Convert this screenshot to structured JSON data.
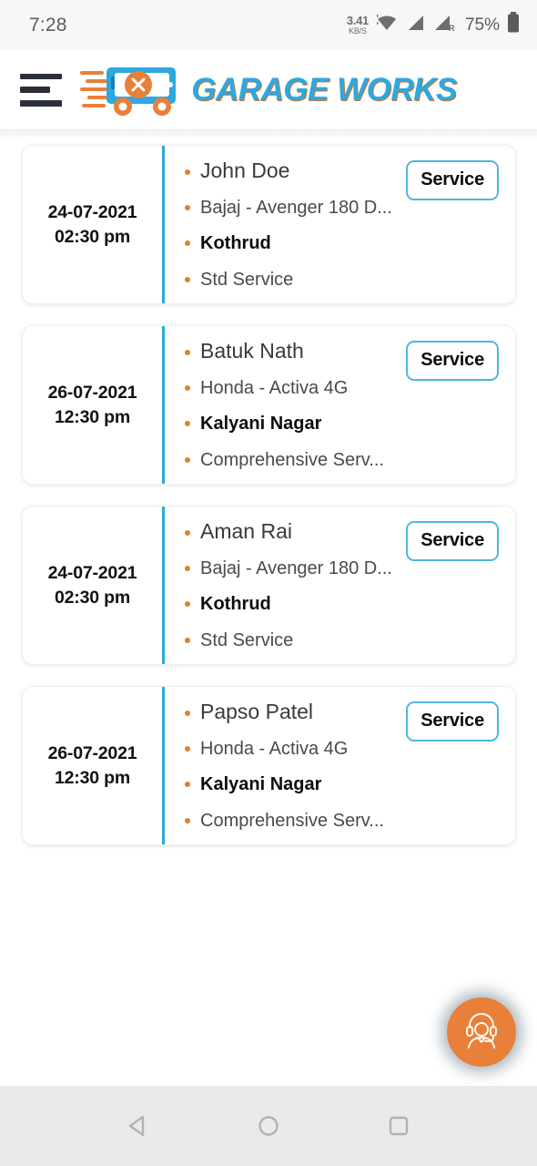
{
  "status_bar": {
    "clock": "7:28",
    "net_speed_value": "3.41",
    "net_speed_unit": "KB/S",
    "wifi_icon": "wifi-icon",
    "signal_icon": "signal-icon",
    "signal_roaming_icon": "signal-roaming-icon",
    "roaming_label": "R",
    "battery_percent": "75%",
    "battery_icon": "battery-icon"
  },
  "header": {
    "menu_icon": "hamburger-menu-icon",
    "logo_icon": "garage-van-icon",
    "logo_text": "GARAGE WORKS"
  },
  "colors": {
    "accent_blue": "#2da8d8",
    "accent_orange": "#e8803a",
    "bullet_orange": "#d9842f",
    "badge_border": "#4fb7dd",
    "status_bg": "#f7f7f7",
    "nav_bg": "#eaeaea"
  },
  "appointments": [
    {
      "date": "24-07-2021",
      "time": "02:30 pm",
      "customer": "John Doe",
      "vehicle": "Bajaj - Avenger 180 D...",
      "location": "Kothrud",
      "service": "Std Service",
      "badge": "Service"
    },
    {
      "date": "26-07-2021",
      "time": "12:30 pm",
      "customer": "Batuk Nath",
      "vehicle": "Honda - Activa 4G",
      "location": "Kalyani Nagar",
      "service": "Comprehensive Serv...",
      "badge": "Service"
    },
    {
      "date": "24-07-2021",
      "time": "02:30 pm",
      "customer": "Aman Rai",
      "vehicle": "Bajaj - Avenger 180 D...",
      "location": "Kothrud",
      "service": "Std Service",
      "badge": "Service"
    },
    {
      "date": "26-07-2021",
      "time": "12:30 pm",
      "customer": "Papso Patel",
      "vehicle": "Honda - Activa 4G",
      "location": "Kalyani Nagar",
      "service": "Comprehensive Serv...",
      "badge": "Service"
    }
  ],
  "fab": {
    "icon": "support-agent-icon"
  },
  "nav_bar": {
    "back_icon": "back-triangle-icon",
    "home_icon": "home-circle-icon",
    "recents_icon": "recents-square-icon"
  }
}
